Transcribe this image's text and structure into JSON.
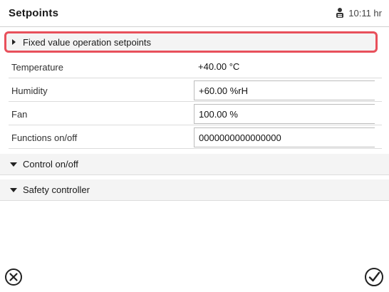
{
  "header": {
    "title": "Setpoints",
    "time": "10:11 hr"
  },
  "section": {
    "label": "Fixed value operation setpoints"
  },
  "rows": [
    {
      "label": "Temperature",
      "value": "+40.00 °C"
    },
    {
      "label": "Humidity",
      "value": "+60.00 %rH"
    },
    {
      "label": "Fan",
      "value": "100.00 %"
    },
    {
      "label": "Functions on/off",
      "value": "0000000000000000"
    }
  ],
  "groups": [
    {
      "label": "Control on/off"
    },
    {
      "label": "Safety controller"
    }
  ],
  "footer": {
    "cancel_icon": "close-circle-icon",
    "confirm_icon": "check-circle-icon"
  }
}
